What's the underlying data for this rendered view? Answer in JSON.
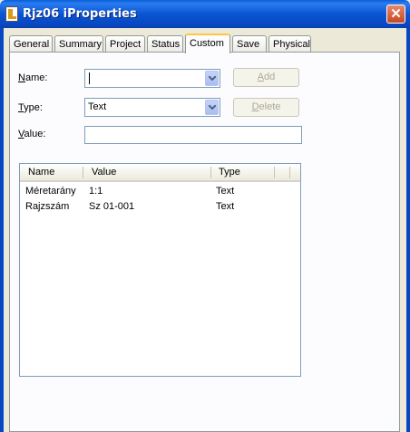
{
  "window": {
    "title": "Rjz06 iProperties",
    "close_label": "✕"
  },
  "tabs": [
    {
      "label": "General"
    },
    {
      "label": "Summary"
    },
    {
      "label": "Project"
    },
    {
      "label": "Status"
    },
    {
      "label": "Custom"
    },
    {
      "label": "Save"
    },
    {
      "label": "Physical"
    }
  ],
  "active_tab": "Custom",
  "form": {
    "name_label_key": "N",
    "name_label_rest": "ame:",
    "name_value": "",
    "type_label_key": "T",
    "type_label_rest": "ype:",
    "type_value": "Text",
    "value_label_key": "V",
    "value_label_rest": "alue:",
    "value_value": "",
    "add_key": "A",
    "add_rest": "dd",
    "delete_key": "D",
    "delete_rest": "elete"
  },
  "list": {
    "columns": [
      "Name",
      "Value",
      "Type"
    ],
    "rows": [
      {
        "name": "Méretarány",
        "value": "1:1",
        "type": "Text"
      },
      {
        "name": "Rajzszám",
        "value": "Sz 01-001",
        "type": "Text"
      }
    ]
  }
}
